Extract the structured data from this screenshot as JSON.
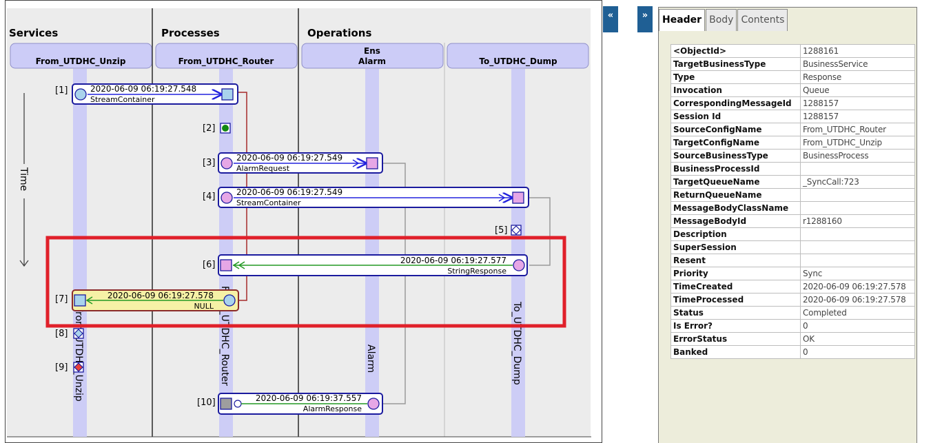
{
  "columns": {
    "services": "Services",
    "processes": "Processes",
    "operations": "Operations"
  },
  "lanes": [
    {
      "title": "From_UTDHC_Unzip",
      "vertical": "From_UTDHC_Unzip"
    },
    {
      "title": "From_UTDHC_Router",
      "vertical": "From_UTDHC_Router"
    },
    {
      "title": "Ens\nAlarm",
      "vertical": "Alarm"
    },
    {
      "title": "To_UTDHC_Dump",
      "vertical": "To_UTDHC_Dump"
    }
  ],
  "time_label": "Time",
  "messages": [
    {
      "index": "[1]",
      "timestamp": "2020-06-09 06:19:27.548",
      "name": "StreamContainer"
    },
    {
      "index": "[2]"
    },
    {
      "index": "[3]",
      "timestamp": "2020-06-09 06:19:27.549",
      "name": "AlarmRequest"
    },
    {
      "index": "[4]",
      "timestamp": "2020-06-09 06:19:27.549",
      "name": "StreamContainer"
    },
    {
      "index": "[5]"
    },
    {
      "index": "[6]",
      "timestamp": "2020-06-09 06:19:27.577",
      "name": "StringResponse"
    },
    {
      "index": "[7]",
      "timestamp": "2020-06-09 06:19:27.578",
      "name": "NULL"
    },
    {
      "index": "[8]"
    },
    {
      "index": "[9]"
    },
    {
      "index": "[10]",
      "timestamp": "2020-06-09 06:19:37.557",
      "name": "AlarmResponse"
    }
  ],
  "nav": {
    "collapse_left": "«",
    "collapse_right": "»"
  },
  "tabs": [
    "Header",
    "Body",
    "Contents"
  ],
  "active_tab": "Header",
  "properties": [
    {
      "key": "<ObjectId>",
      "value": "1288161"
    },
    {
      "key": "TargetBusinessType",
      "value": "BusinessService"
    },
    {
      "key": "Type",
      "value": "Response"
    },
    {
      "key": "Invocation",
      "value": "Queue"
    },
    {
      "key": "CorrespondingMessageId",
      "value": "1288157"
    },
    {
      "key": "Session Id",
      "value": "1288157"
    },
    {
      "key": "SourceConfigName",
      "value": "From_UTDHC_Router"
    },
    {
      "key": "TargetConfigName",
      "value": "From_UTDHC_Unzip"
    },
    {
      "key": "SourceBusinessType",
      "value": "BusinessProcess"
    },
    {
      "key": "BusinessProcessId",
      "value": ""
    },
    {
      "key": "TargetQueueName",
      "value": "_SyncCall:723"
    },
    {
      "key": "ReturnQueueName",
      "value": ""
    },
    {
      "key": "MessageBodyClassName",
      "value": ""
    },
    {
      "key": "MessageBodyId",
      "value": "r1288160"
    },
    {
      "key": "Description",
      "value": ""
    },
    {
      "key": "SuperSession",
      "value": ""
    },
    {
      "key": "Resent",
      "value": ""
    },
    {
      "key": "Priority",
      "value": "Sync"
    },
    {
      "key": "TimeCreated",
      "value": "2020-06-09 06:19:27.578"
    },
    {
      "key": "TimeProcessed",
      "value": "2020-06-09 06:19:27.578"
    },
    {
      "key": "Status",
      "value": "Completed"
    },
    {
      "key": "Is Error?",
      "value": "0"
    },
    {
      "key": "ErrorStatus",
      "value": "OK"
    },
    {
      "key": "Banked",
      "value": "0"
    }
  ],
  "colors": {
    "lane_header": "#ccccf7",
    "lane_bar": "#cdcdf6",
    "request_arrow": "#2222dd",
    "response_arrow": "#229922",
    "highlight_box": "#e0202a",
    "selected_fill": "#f6f1a6",
    "panel_bg": "#ededdb",
    "nav_blue": "#1f5f94"
  }
}
